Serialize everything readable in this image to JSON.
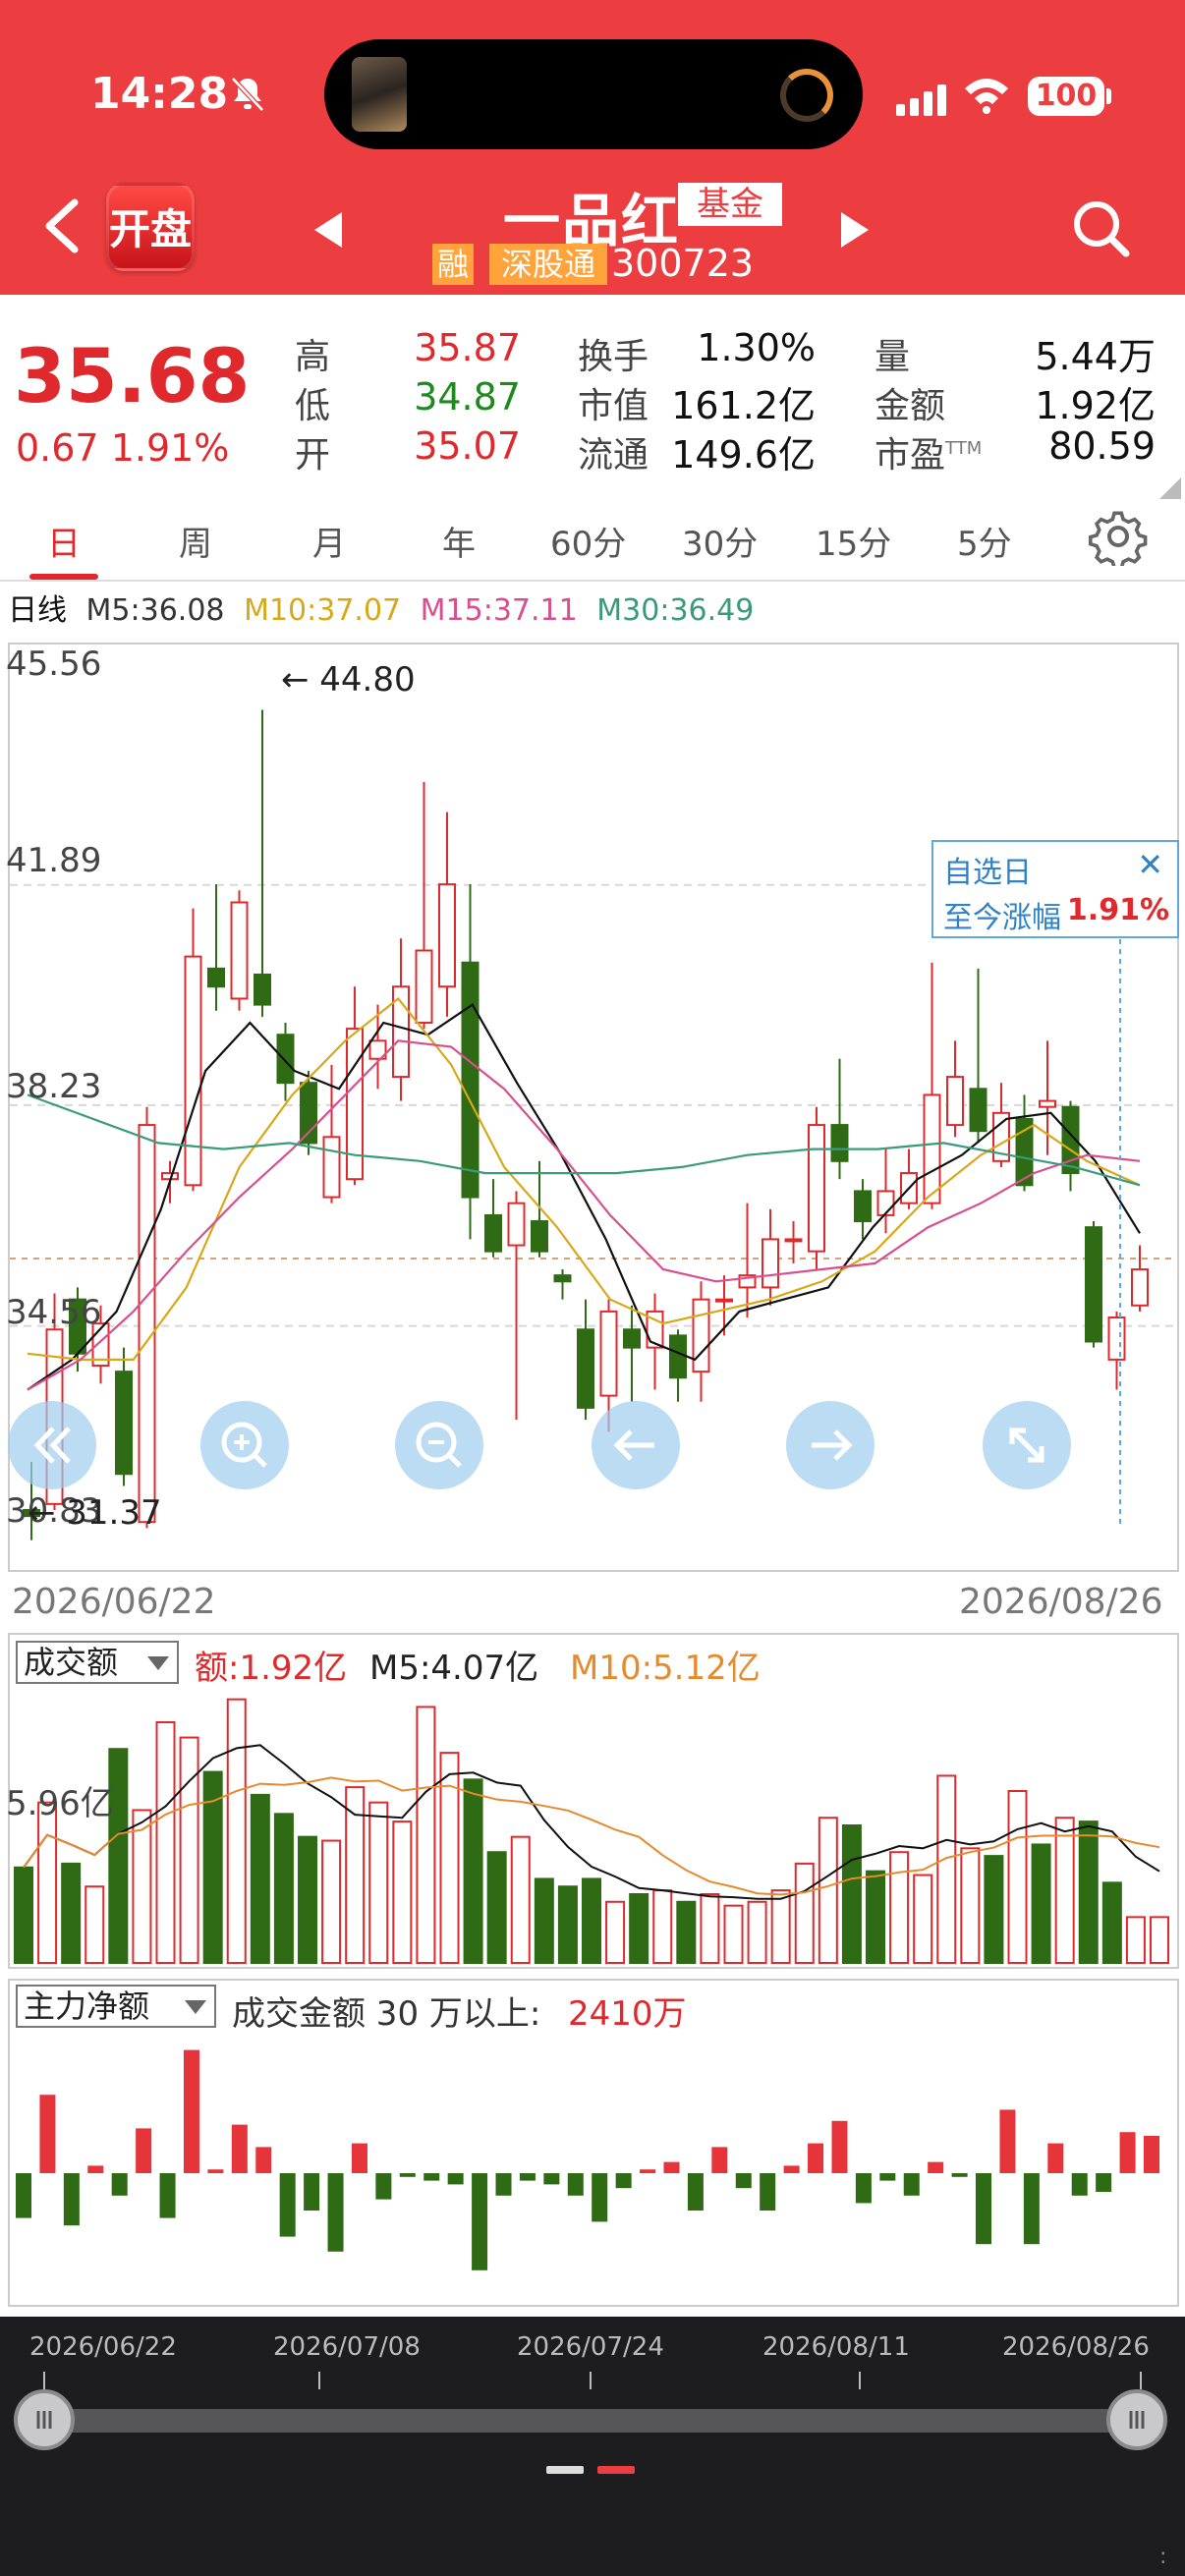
{
  "status_bar": {
    "time": "14:28",
    "battery": "100"
  },
  "header": {
    "logo": "开盘",
    "stock_name": "一品红",
    "type_badge": "基金",
    "badge_rong": "融",
    "badge_sgt": "深股通",
    "code": "300723"
  },
  "quote": {
    "price": "35.68",
    "change": "0.67 1.91%",
    "high_label": "高",
    "high": "35.87",
    "low_label": "低",
    "low": "34.87",
    "open_label": "开",
    "open": "35.07",
    "turnover_label": "换手",
    "turnover": "1.30%",
    "mktcap_label": "市值",
    "mktcap": "161.2亿",
    "float_label": "流通",
    "float": "149.6亿",
    "volume_label": "量",
    "volume": "5.44万",
    "amount_label": "金额",
    "amount": "1.92亿",
    "pe_label": "市盈",
    "pe_suffix": "TTM",
    "pe": "80.59"
  },
  "tabs": [
    "日",
    "周",
    "月",
    "年",
    "60分",
    "30分",
    "15分",
    "5分"
  ],
  "active_tab": "日",
  "ma_legend": {
    "period": "日线",
    "m5": "M5:36.08",
    "m10": "M10:37.07",
    "m15": "M15:37.11",
    "m30": "M30:36.49"
  },
  "price_axis": [
    "45.56",
    "41.89",
    "38.23",
    "34.56",
    "30.83"
  ],
  "annotations": {
    "high": "44.80",
    "low": "31.37"
  },
  "popup": {
    "line1": "自选日",
    "line2": "至今涨幅",
    "value": "1.91%",
    "close": "✕"
  },
  "date_range": {
    "start": "2026/06/22",
    "end": "2026/08/26"
  },
  "volume": {
    "selector": "成交额",
    "amount": "额:1.92亿",
    "m5": "M5:4.07亿",
    "m10": "M10:5.12亿",
    "axis_label": "5.96亿"
  },
  "money_flow": {
    "selector": "主力净额",
    "desc": "成交金额 30 万以上:",
    "value": "2410万"
  },
  "timeline": [
    "2026/06/22",
    "2026/07/08",
    "2026/07/24",
    "2026/08/11",
    "2026/08/26"
  ],
  "colors": {
    "up": "#e0292c",
    "down": "#2e6b14",
    "m5": "#111111",
    "m10": "#d8a818",
    "m15": "#d84f8c",
    "m30": "#3a9a7c",
    "header": "#ec3e41"
  },
  "chart_data": [
    {
      "type": "candlestick",
      "title": "日线",
      "x": [
        "2026/06/22",
        "2026/08/26"
      ],
      "ylim": [
        30.83,
        45.56
      ],
      "candles": [
        {
          "o": 31.5,
          "c": 31.4,
          "h": 32.3,
          "l": 31.0
        },
        {
          "o": 31.6,
          "c": 34.5,
          "h": 35.1,
          "l": 31.5
        },
        {
          "o": 35.0,
          "c": 34.1,
          "h": 35.2,
          "l": 33.8
        },
        {
          "o": 33.9,
          "c": 34.6,
          "h": 34.9,
          "l": 33.6
        },
        {
          "o": 33.8,
          "c": 32.1,
          "h": 34.2,
          "l": 31.9
        },
        {
          "o": 31.3,
          "c": 37.9,
          "h": 38.2,
          "l": 31.2
        },
        {
          "o": 37.0,
          "c": 37.1,
          "h": 37.3,
          "l": 36.6
        },
        {
          "o": 36.9,
          "c": 40.7,
          "h": 41.5,
          "l": 36.8
        },
        {
          "o": 40.5,
          "c": 40.2,
          "h": 41.9,
          "l": 39.8
        },
        {
          "o": 40.0,
          "c": 41.6,
          "h": 41.8,
          "l": 39.8
        },
        {
          "o": 40.4,
          "c": 39.9,
          "h": 44.8,
          "l": 39.7
        },
        {
          "o": 39.4,
          "c": 38.6,
          "h": 39.6,
          "l": 38.3
        },
        {
          "o": 38.6,
          "c": 37.6,
          "h": 38.8,
          "l": 37.4
        },
        {
          "o": 36.7,
          "c": 37.7,
          "h": 38.9,
          "l": 36.6
        },
        {
          "o": 37.0,
          "c": 39.5,
          "h": 40.2,
          "l": 36.9
        },
        {
          "o": 39.0,
          "c": 39.3,
          "h": 39.9,
          "l": 38.5
        },
        {
          "o": 38.7,
          "c": 40.2,
          "h": 41.0,
          "l": 38.3
        },
        {
          "o": 39.6,
          "c": 40.8,
          "h": 43.6,
          "l": 39.5
        },
        {
          "o": 40.2,
          "c": 41.9,
          "h": 43.1,
          "l": 39.7
        },
        {
          "o": 40.6,
          "c": 36.7,
          "h": 41.9,
          "l": 36.0
        },
        {
          "o": 36.4,
          "c": 35.8,
          "h": 37.0,
          "l": 35.7
        },
        {
          "o": 35.9,
          "c": 36.6,
          "h": 36.8,
          "l": 33.0
        },
        {
          "o": 36.3,
          "c": 35.8,
          "h": 37.3,
          "l": 35.7
        },
        {
          "o": 35.4,
          "c": 35.3,
          "h": 35.5,
          "l": 35.0
        },
        {
          "o": 34.5,
          "c": 33.2,
          "h": 35.0,
          "l": 33.0
        },
        {
          "o": 33.4,
          "c": 34.8,
          "h": 35.0,
          "l": 32.8
        },
        {
          "o": 34.5,
          "c": 34.2,
          "h": 34.9,
          "l": 33.3
        },
        {
          "o": 34.2,
          "c": 34.8,
          "h": 35.1,
          "l": 33.5
        },
        {
          "o": 34.4,
          "c": 33.7,
          "h": 34.5,
          "l": 33.3
        },
        {
          "o": 33.8,
          "c": 35.0,
          "h": 35.3,
          "l": 33.3
        },
        {
          "o": 35.0,
          "c": 35.0,
          "h": 35.4,
          "l": 34.4
        },
        {
          "o": 35.2,
          "c": 35.4,
          "h": 36.6,
          "l": 34.7
        },
        {
          "o": 35.2,
          "c": 36.0,
          "h": 36.5,
          "l": 34.9
        },
        {
          "o": 36.0,
          "c": 36.0,
          "h": 36.3,
          "l": 35.6
        },
        {
          "o": 35.8,
          "c": 37.9,
          "h": 38.2,
          "l": 35.5
        },
        {
          "o": 37.9,
          "c": 37.3,
          "h": 39.0,
          "l": 37.0
        },
        {
          "o": 36.8,
          "c": 36.3,
          "h": 37.0,
          "l": 36.0
        },
        {
          "o": 36.4,
          "c": 36.8,
          "h": 37.5,
          "l": 36.1
        },
        {
          "o": 36.6,
          "c": 37.1,
          "h": 37.5,
          "l": 36.5
        },
        {
          "o": 36.6,
          "c": 38.4,
          "h": 40.6,
          "l": 36.5
        },
        {
          "o": 37.9,
          "c": 38.7,
          "h": 39.3,
          "l": 37.7
        },
        {
          "o": 38.5,
          "c": 37.8,
          "h": 40.5,
          "l": 37.6
        },
        {
          "o": 37.3,
          "c": 38.1,
          "h": 38.6,
          "l": 37.2
        },
        {
          "o": 38.0,
          "c": 36.9,
          "h": 38.4,
          "l": 36.8
        },
        {
          "o": 38.2,
          "c": 38.3,
          "h": 39.3,
          "l": 37.4
        },
        {
          "o": 38.2,
          "c": 37.1,
          "h": 38.3,
          "l": 36.8
        },
        {
          "o": 36.2,
          "c": 34.3,
          "h": 36.3,
          "l": 34.2
        },
        {
          "o": 34.0,
          "c": 34.7,
          "h": 34.8,
          "l": 33.5
        },
        {
          "o": 34.9,
          "c": 35.5,
          "h": 35.9,
          "l": 34.8
        }
      ],
      "series": [
        {
          "name": "M5",
          "values": [
            33.5,
            34.0,
            34.8,
            36.5,
            38.8,
            39.6,
            38.8,
            38.5,
            39.6,
            39.4,
            39.9,
            38.6,
            37.4,
            36.0,
            34.3,
            34.0,
            34.8,
            35.0,
            35.2,
            36.2,
            37.0,
            37.4,
            38.0,
            38.1,
            37.3,
            36.1
          ]
        },
        {
          "name": "M10",
          "values": [
            34.1,
            34.0,
            34.0,
            35.2,
            37.2,
            38.4,
            39.3,
            40.0,
            38.9,
            37.2,
            36.2,
            35.0,
            34.6,
            34.8,
            35.0,
            35.3,
            35.8,
            36.7,
            37.4,
            37.9,
            37.3,
            36.9
          ]
        },
        {
          "name": "M15",
          "values": [
            33.5,
            34.0,
            34.8,
            35.8,
            36.7,
            37.5,
            38.4,
            39.3,
            39.2,
            38.5,
            37.5,
            36.4,
            35.5,
            35.3,
            35.4,
            35.5,
            35.6,
            36.2,
            36.6,
            37.1,
            37.4,
            37.3
          ]
        },
        {
          "name": "M30",
          "values": [
            38.4,
            38.0,
            37.6,
            37.5,
            37.6,
            37.4,
            37.3,
            37.1,
            37.1,
            37.1,
            37.2,
            37.4,
            37.5,
            37.5,
            37.6,
            37.4,
            37.2,
            36.9
          ]
        }
      ]
    },
    {
      "type": "bar",
      "title": "成交额",
      "units": "亿",
      "values": [
        2.5,
        4.2,
        2.6,
        2.0,
        5.6,
        4.0,
        6.3,
        5.9,
        5.0,
        6.9,
        4.4,
        3.9,
        3.3,
        3.2,
        4.6,
        4.2,
        3.7,
        6.7,
        5.5,
        4.8,
        2.9,
        3.3,
        2.2,
        2.0,
        2.2,
        1.6,
        1.8,
        1.9,
        1.6,
        1.8,
        1.5,
        1.6,
        1.9,
        2.6,
        3.8,
        3.6,
        2.4,
        2.9,
        2.3,
        4.9,
        3.0,
        2.8,
        4.5,
        3.1,
        3.8,
        3.7,
        2.1,
        1.2,
        1.2
      ],
      "series": [
        {
          "name": "M5"
        },
        {
          "name": "M10"
        }
      ]
    },
    {
      "type": "bar",
      "title": "主力净额",
      "values": [
        -1.2,
        2.1,
        -1.4,
        0.2,
        -0.6,
        1.2,
        -1.2,
        3.3,
        0.1,
        1.3,
        0.7,
        -1.7,
        -1.0,
        -2.1,
        0.8,
        -0.7,
        -0.1,
        -0.2,
        -0.3,
        -2.6,
        -0.6,
        -0.2,
        -0.3,
        -0.6,
        -1.3,
        -0.4,
        0.1,
        0.3,
        -1.0,
        0.7,
        -0.4,
        -1.0,
        0.2,
        0.8,
        1.4,
        -0.8,
        -0.2,
        -0.6,
        0.3,
        -0.1,
        -1.9,
        1.7,
        -1.9,
        0.8,
        -0.6,
        -0.5,
        1.1,
        1.0
      ]
    }
  ]
}
